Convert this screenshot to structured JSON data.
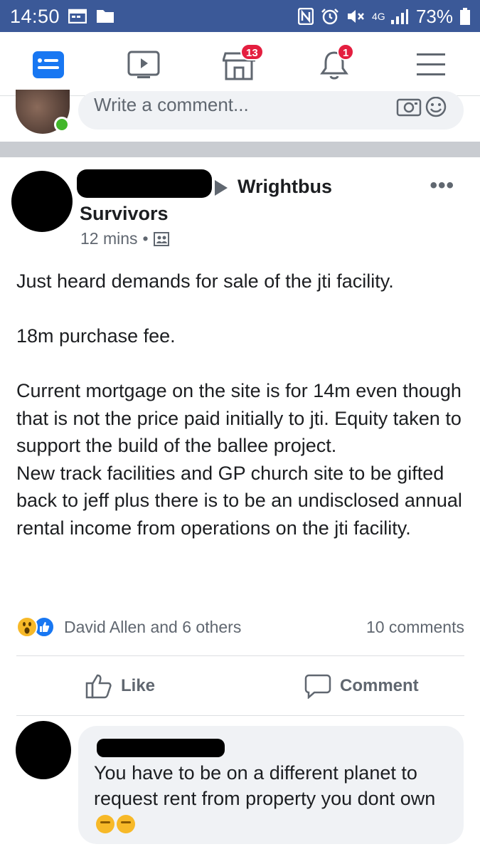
{
  "status_bar": {
    "time": "14:50",
    "battery": "73%",
    "network": "4G"
  },
  "nav": {
    "marketplace_badge": "13",
    "notifications_badge": "1"
  },
  "composer": {
    "placeholder": "Write a comment..."
  },
  "post": {
    "group_line1": "Wrightbus",
    "group_line2": "Survivors",
    "time": "12 mins",
    "more": "•••",
    "body": [
      "Just heard demands for sale of the jti facility.",
      "",
      "18m purchase fee.",
      "",
      "Current mortgage on the site is for 14m even though that is not the price paid initially to jti. Equity taken to support the build of the ballee project.",
      "New track facilities and GP church site to be gifted back to jeff plus there is to be an undisclosed annual rental income from operations on the jti facility."
    ],
    "reactions_text": "David Allen and 6 others",
    "comments_count": "10 comments",
    "like_label": "Like",
    "comment_label": "Comment"
  },
  "comment": {
    "text": "You have to be on a different planet to request rent from property you dont own"
  },
  "colors": {
    "brand": "#3b5998",
    "accent": "#1877f2",
    "badge": "#e41e3f"
  },
  "icons": [
    "news-feed-icon",
    "watch-icon",
    "marketplace-icon",
    "bell-icon",
    "menu-icon",
    "camera-icon",
    "smiley-icon",
    "public-icon",
    "wow-reaction-icon",
    "like-reaction-icon",
    "thumbs-up-icon",
    "speech-bubble-icon",
    "thinking-face-icon"
  ]
}
